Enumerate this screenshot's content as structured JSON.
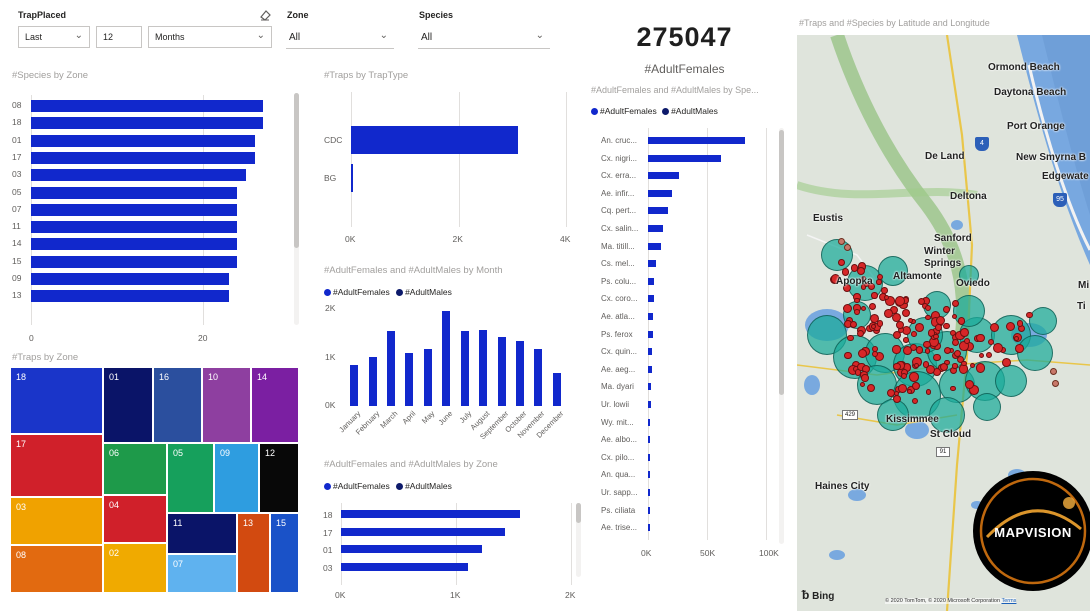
{
  "filters": {
    "trap_placed": {
      "label": "TrapPlaced",
      "mode": "Last",
      "count": "12",
      "unit": "Months"
    },
    "zone": {
      "label": "Zone",
      "value": "All"
    },
    "species": {
      "label": "Species",
      "value": "All"
    }
  },
  "kpi": {
    "value": "275047",
    "label": "#AdultFemales"
  },
  "colors": {
    "bar": "#1128cc",
    "males": "#0d1a6b",
    "map_bubble": "#1aab9a",
    "map_point": "#d62728"
  },
  "species_by_zone": {
    "title": "#Species by Zone",
    "chart_data": {
      "type": "bar",
      "orientation": "horizontal",
      "categories": [
        "08",
        "18",
        "01",
        "17",
        "03",
        "05",
        "07",
        "11",
        "14",
        "15",
        "09",
        "13"
      ],
      "values": [
        27,
        27,
        26,
        26,
        25,
        24,
        24,
        24,
        24,
        24,
        23,
        23
      ],
      "xlim": [
        0,
        30
      ],
      "xticks": [
        "0",
        "20"
      ],
      "title": "#Species by Zone"
    }
  },
  "traps_by_traptype": {
    "title": "#Traps by TrapType",
    "chart_data": {
      "type": "bar",
      "orientation": "horizontal",
      "categories": [
        "CDC",
        "BG"
      ],
      "values": [
        3100,
        30
      ],
      "xlim": [
        0,
        4000
      ],
      "xticks": [
        "0K",
        "2K",
        "4K"
      ],
      "title": "#Traps by TrapType"
    }
  },
  "by_month": {
    "title": "#AdultFemales and #AdultMales by Month",
    "legend": [
      "#AdultFemales",
      "#AdultMales"
    ],
    "chart_data": {
      "type": "bar",
      "categories": [
        "January",
        "February",
        "March",
        "April",
        "May",
        "June",
        "July",
        "August",
        "September",
        "October",
        "November",
        "December"
      ],
      "series": [
        {
          "name": "#AdultFemales",
          "values": [
            850,
            1020,
            1550,
            1090,
            1180,
            1950,
            1540,
            1560,
            1420,
            1330,
            1180,
            690
          ]
        },
        {
          "name": "#AdultMales",
          "values": [
            0,
            0,
            0,
            0,
            0,
            0,
            0,
            0,
            0,
            0,
            0,
            0
          ]
        }
      ],
      "ylim": [
        0,
        2000
      ],
      "yticks": [
        "0K",
        "1K",
        "2K"
      ],
      "title": "#AdultFemales and #AdultMales by Month"
    }
  },
  "by_zone": {
    "title": "#AdultFemales and #AdultMales by Zone",
    "legend": [
      "#AdultFemales",
      "#AdultMales"
    ],
    "chart_data": {
      "type": "bar",
      "orientation": "horizontal",
      "categories": [
        "18",
        "17",
        "01",
        "03"
      ],
      "series": [
        {
          "name": "#AdultFemales",
          "values": [
            1560,
            1430,
            1230,
            1100
          ]
        },
        {
          "name": "#AdultMales",
          "values": [
            0,
            0,
            0,
            0
          ]
        }
      ],
      "xlim": [
        0,
        2000
      ],
      "xticks": [
        "0K",
        "1K",
        "2K"
      ],
      "title": "#AdultFemales and #AdultMales by Zone"
    }
  },
  "by_species": {
    "title": "#AdultFemales and #AdultMales by Spe...",
    "legend": [
      "#AdultFemales",
      "#AdultMales"
    ],
    "chart_data": {
      "type": "bar",
      "orientation": "horizontal",
      "categories": [
        "An. cruc...",
        "Cx. nigri...",
        "Cx. erra...",
        "Ae. infir...",
        "Cq. pert...",
        "Cx. salin...",
        "Ma. titill...",
        "Cs. mel...",
        "Ps. colu...",
        "Cx. coro...",
        "Ae. atla...",
        "Ps. ferox",
        "Cx. quin...",
        "Ae. aeg...",
        "Ma. dyari",
        "Ur. lowii",
        "Wy. mit...",
        "Ae. albo...",
        "Cx. pilo...",
        "An. qua...",
        "Ur. sapp...",
        "Ps. ciliata",
        "Ae. trise..."
      ],
      "series": [
        {
          "name": "#AdultFemales",
          "values": [
            82000,
            62000,
            26000,
            20000,
            17000,
            13000,
            11000,
            6500,
            5500,
            5000,
            4500,
            4000,
            3500,
            3000,
            2700,
            2300,
            2000,
            1700,
            1500,
            1300,
            1100,
            900,
            700
          ]
        },
        {
          "name": "#AdultMales",
          "values": [
            0,
            0,
            0,
            0,
            0,
            0,
            0,
            0,
            0,
            0,
            0,
            0,
            0,
            0,
            0,
            0,
            0,
            0,
            0,
            0,
            0,
            0,
            0
          ]
        }
      ],
      "xlim": [
        0,
        100000
      ],
      "xticks": [
        "0K",
        "50K",
        "100K"
      ],
      "title": "#AdultFemales and #AdultMales by Spe..."
    }
  },
  "traps_by_zone": {
    "title": "#Traps by Zone",
    "tiles": [
      {
        "label": "18",
        "color": "#1a35c9"
      },
      {
        "label": "01",
        "color": "#0a1468"
      },
      {
        "label": "16",
        "color": "#2b4f9e"
      },
      {
        "label": "10",
        "color": "#8e3fa0"
      },
      {
        "label": "14",
        "color": "#7b1fa2"
      },
      {
        "label": "17",
        "color": "#d0202a"
      },
      {
        "label": "06",
        "color": "#1e9a4a"
      },
      {
        "label": "05",
        "color": "#16a05c"
      },
      {
        "label": "09",
        "color": "#2e9de0"
      },
      {
        "label": "12",
        "color": "#080808"
      },
      {
        "label": "03",
        "color": "#f0a200"
      },
      {
        "label": "04",
        "color": "#d0202a"
      },
      {
        "label": "11",
        "color": "#0a1468"
      },
      {
        "label": "13",
        "color": "#d24a10"
      },
      {
        "label": "15",
        "color": "#1a52c8"
      },
      {
        "label": "08",
        "color": "#e26a10"
      },
      {
        "label": "02",
        "color": "#f0aa00"
      },
      {
        "label": "07",
        "color": "#5fb2ef"
      }
    ]
  },
  "map": {
    "title": "#Traps and #Species by Latitude and Longitude",
    "towns": [
      "Ormond Beach",
      "Daytona Beach",
      "Port Orange",
      "De Land",
      "New Smyrna B",
      "Edgewate",
      "Deltona",
      "Eustis",
      "Sanford",
      "Winter",
      "Springs",
      "Apopka",
      "Altamonte",
      "Oviedo",
      "Kissimmee",
      "St Cloud",
      "Haines City",
      "Ti",
      "Mi"
    ],
    "roads": [
      "4",
      "95",
      "429",
      "91"
    ],
    "logo": "MAPVISION",
    "bing": "Bing",
    "copyright": "© 2020 TomTom, © 2020 Microsoft Corporation",
    "terms": "Terms"
  }
}
